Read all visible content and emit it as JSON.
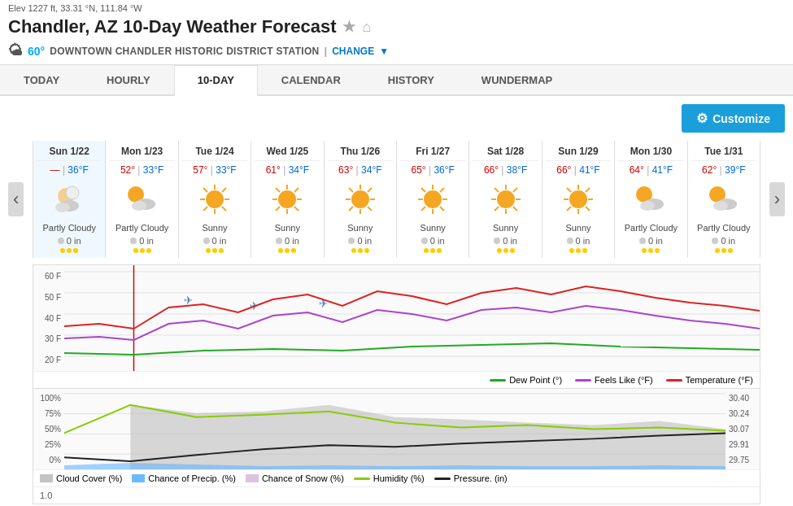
{
  "elevation": "Elev 1227 ft, 33.31 °N, 111.84 °W",
  "title": "Chandler, AZ 10-Day Weather Forecast",
  "station": {
    "temp": "60°",
    "name": "DOWNTOWN CHANDLER HISTORIC DISTRICT STATION",
    "change_label": "CHANGE"
  },
  "tabs": [
    {
      "label": "TODAY",
      "active": false
    },
    {
      "label": "HOURLY",
      "active": false
    },
    {
      "label": "10-DAY",
      "active": true
    },
    {
      "label": "CALENDAR",
      "active": false
    },
    {
      "label": "HISTORY",
      "active": false
    },
    {
      "label": "WUNDERMAP",
      "active": false
    }
  ],
  "customize_label": "Customize",
  "forecast_days": [
    {
      "date": "Sun 1/22",
      "hi": "—",
      "lo": "36°F",
      "hi_color": "red",
      "icon": "partly-cloudy-night",
      "desc": "Partly Cloudy",
      "precip": "0 in",
      "current": true
    },
    {
      "date": "Mon 1/23",
      "hi": "52°",
      "lo": "33°F",
      "icon": "partly-cloudy-day",
      "desc": "Partly Cloudy",
      "precip": "0 in"
    },
    {
      "date": "Tue 1/24",
      "hi": "57°",
      "lo": "33°F",
      "icon": "sunny",
      "desc": "Sunny",
      "precip": "0 in"
    },
    {
      "date": "Wed 1/25",
      "hi": "61°",
      "lo": "34°F",
      "icon": "sunny",
      "desc": "Sunny",
      "precip": "0 in"
    },
    {
      "date": "Thu 1/26",
      "hi": "63°",
      "lo": "34°F",
      "icon": "sunny",
      "desc": "Sunny",
      "precip": "0 in"
    },
    {
      "date": "Fri 1/27",
      "hi": "65°",
      "lo": "36°F",
      "icon": "sunny",
      "desc": "Sunny",
      "precip": "0 in"
    },
    {
      "date": "Sat 1/28",
      "hi": "66°",
      "lo": "38°F",
      "icon": "sunny",
      "desc": "Sunny",
      "precip": "0 in"
    },
    {
      "date": "Sun 1/29",
      "hi": "66°",
      "lo": "41°F",
      "icon": "sunny",
      "desc": "Sunny",
      "precip": "0 in"
    },
    {
      "date": "Mon 1/30",
      "hi": "64°",
      "lo": "41°F",
      "icon": "partly-cloudy-day",
      "desc": "Partly Cloudy",
      "precip": "0 in"
    },
    {
      "date": "Tue 1/31",
      "hi": "62°",
      "lo": "39°F",
      "icon": "partly-cloudy-day",
      "desc": "Partly Cloudy",
      "precip": "0 in"
    }
  ],
  "temp_chart": {
    "y_labels": [
      "60 F",
      "50 F",
      "40 F",
      "30 F",
      "20 F"
    ],
    "legend": [
      {
        "label": "Dew Point (°)",
        "color": "#22aa22"
      },
      {
        "label": "Feels Like (°F)",
        "color": "#aa44cc"
      },
      {
        "label": "Temperature (°F)",
        "color": "#dd2222"
      }
    ]
  },
  "lower_chart": {
    "y_labels_left": [
      "100%",
      "75%",
      "50%",
      "25%",
      "0%"
    ],
    "y_labels_right": [
      "30.40",
      "30.24",
      "30.07",
      "29.91",
      "29.75"
    ],
    "legend": [
      {
        "label": "Cloud Cover (%)",
        "color": "#aaaaaa",
        "type": "area"
      },
      {
        "label": "Chance of Precip. (%)",
        "color": "#44aaff",
        "type": "area"
      },
      {
        "label": "Chance of Snow (%)",
        "color": "#ccaacc",
        "type": "area"
      },
      {
        "label": "Humidity (%)",
        "color": "#88cc00",
        "type": "line"
      },
      {
        "label": "Pressure. (in)",
        "color": "#222222",
        "type": "line"
      }
    ]
  },
  "bottom_value": "1.0"
}
